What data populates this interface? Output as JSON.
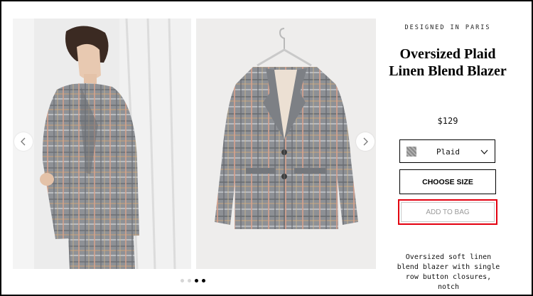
{
  "product": {
    "designed_in": "DESIGNED IN PARIS",
    "title": "Oversized Plaid Linen Blend Blazer",
    "price": "$129",
    "color_option": "Plaid",
    "choose_size_label": "CHOOSE SIZE",
    "add_to_bag_label": "ADD TO BAG",
    "description": "Oversized soft linen blend blazer with single row button closures, notch"
  },
  "gallery": {
    "dot_count": 4,
    "active_dots": [
      2,
      3
    ]
  },
  "colors": {
    "highlight": "#e3000f",
    "disabled_text": "#9a9a9a"
  }
}
